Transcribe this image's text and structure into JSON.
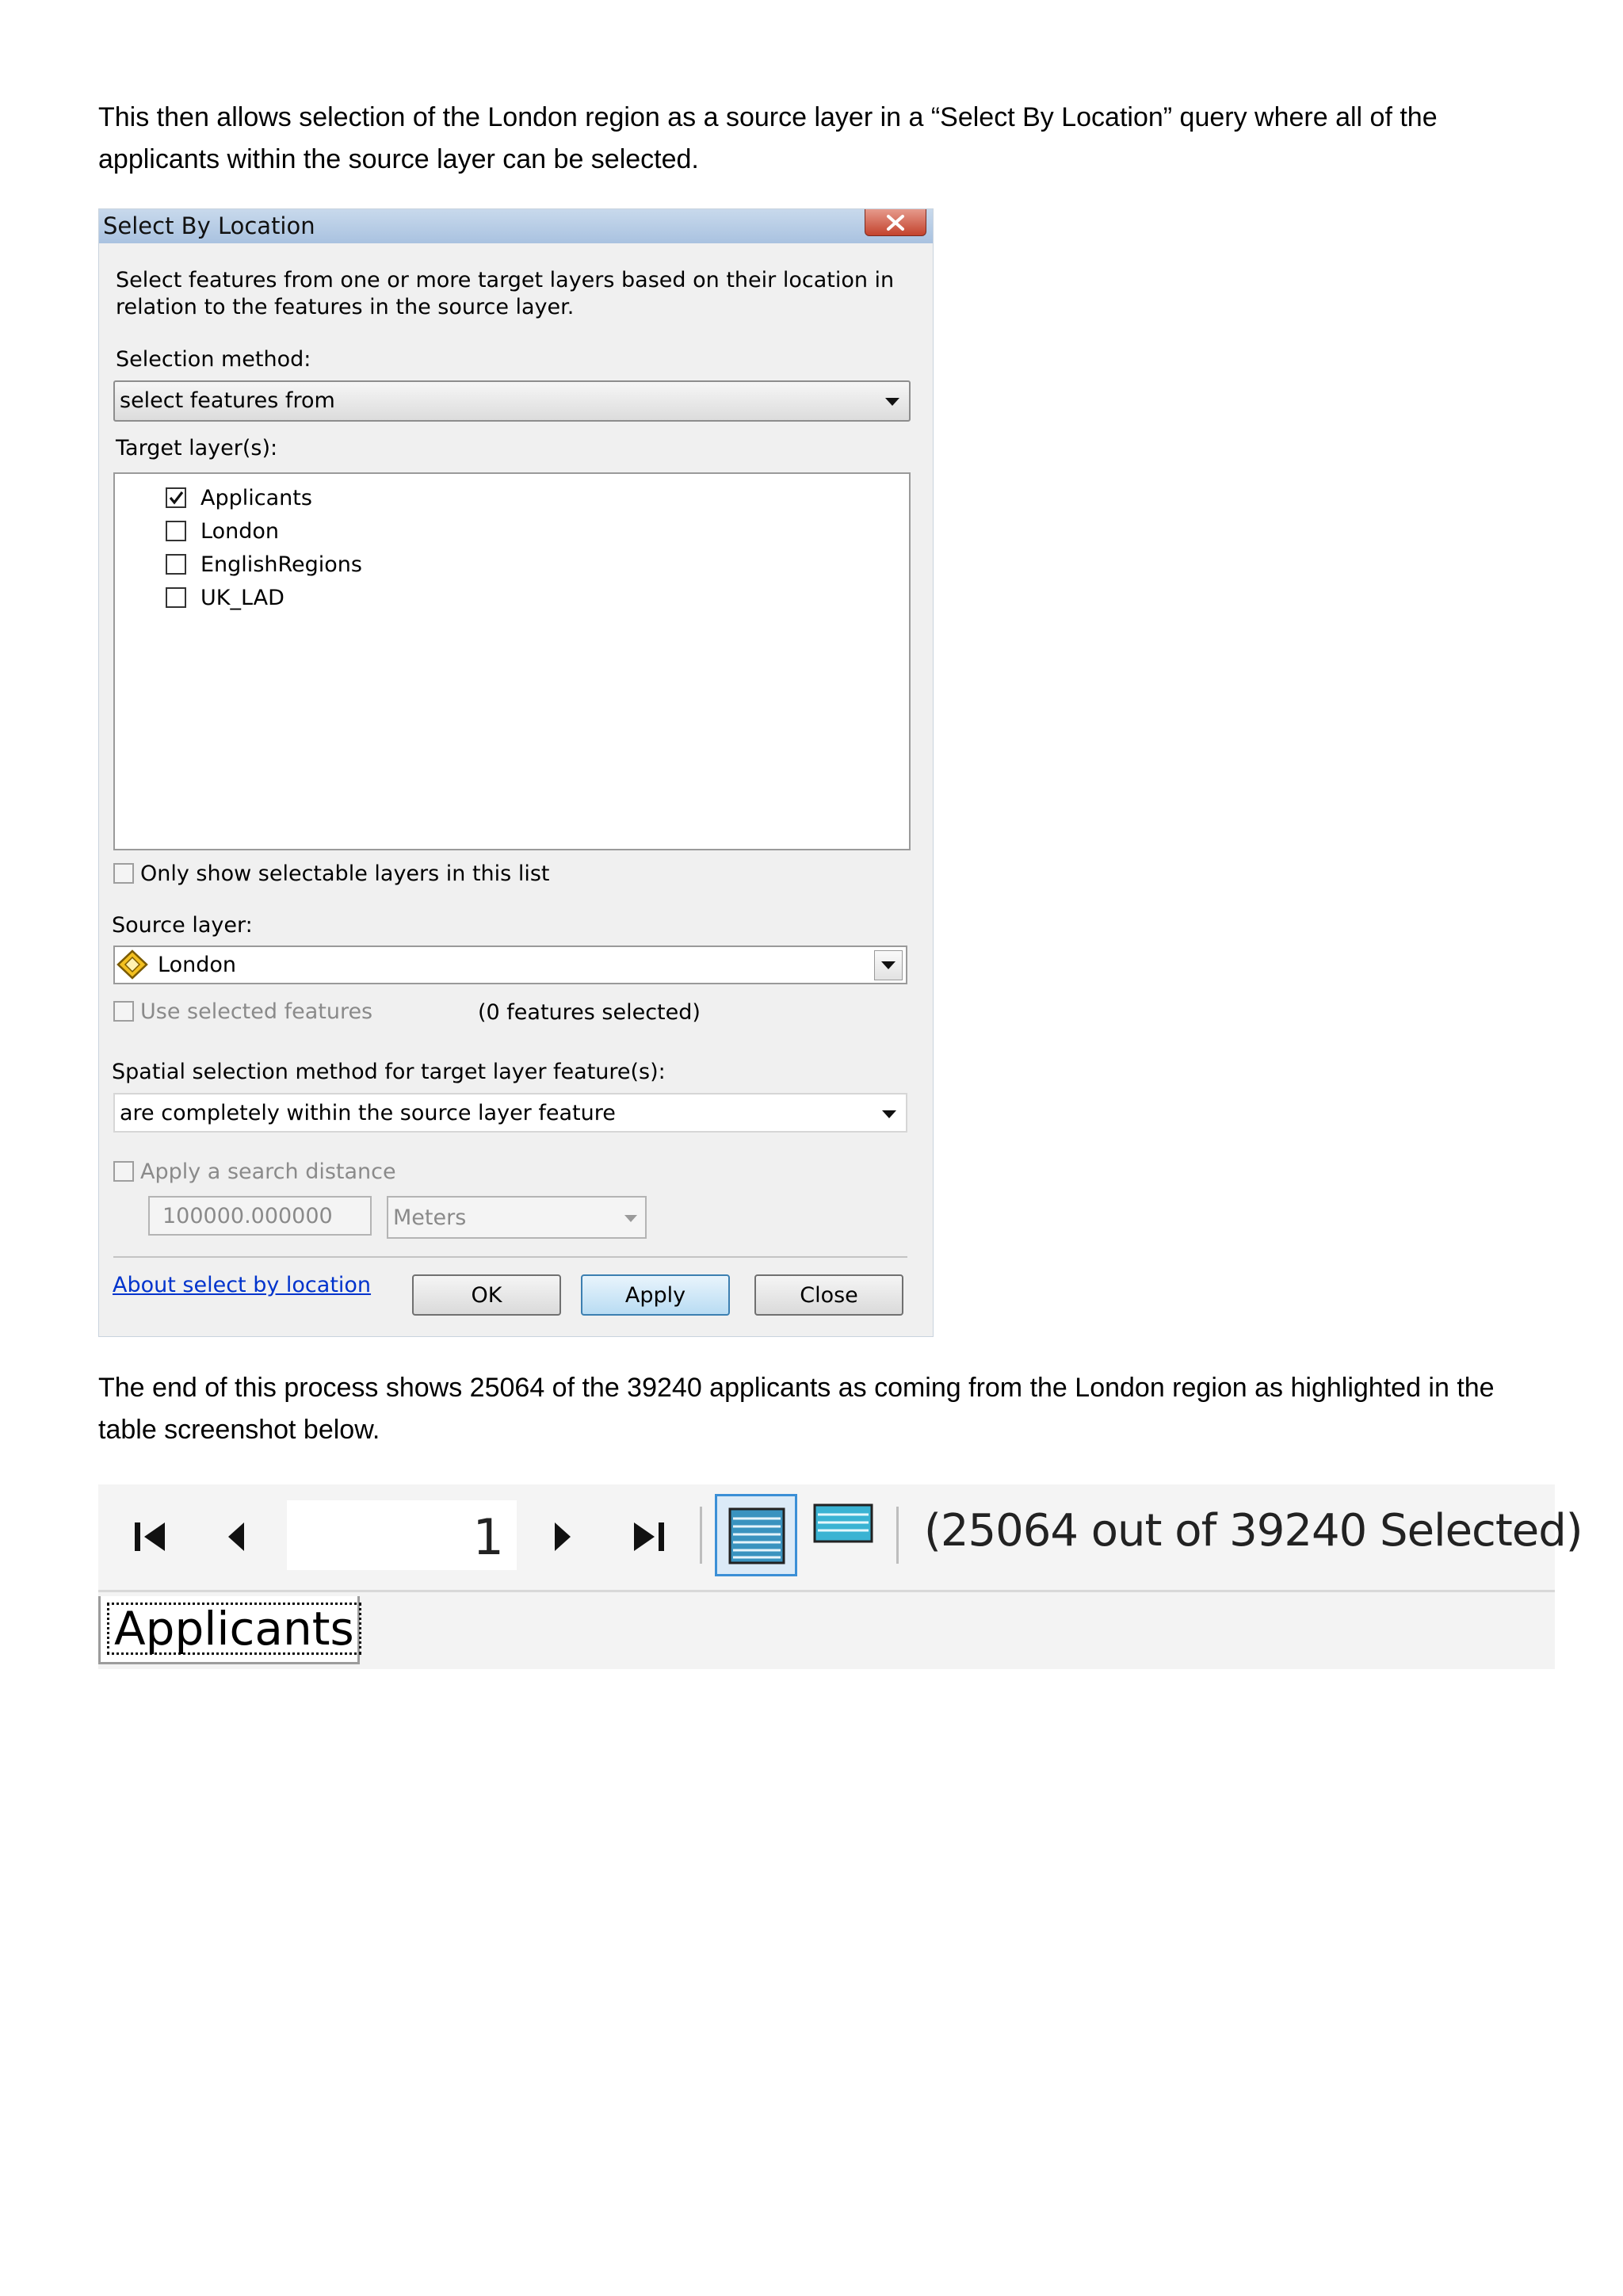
{
  "intro_text": "This then allows selection of the London region as a source layer in a “Select By Location” query where all of the applicants within the source layer can be selected.",
  "dialog": {
    "title": "Select By Location",
    "description_line1": "Select features from one or more target layers based on their location in",
    "description_line2": "relation to the features in the source layer.",
    "selection_method_label": "Selection method:",
    "selection_method_value": "select features from",
    "target_layers_label": "Target layer(s):",
    "target_layers": [
      {
        "name": "Applicants",
        "checked": true
      },
      {
        "name": "London",
        "checked": false
      },
      {
        "name": "EnglishRegions",
        "checked": false
      },
      {
        "name": "UK_LAD",
        "checked": false
      }
    ],
    "only_selectable_label": "Only show selectable layers in this list",
    "source_layer_label": "Source layer:",
    "source_layer_value": "London",
    "use_selected_label": "Use selected features",
    "features_selected": "(0 features selected)",
    "spatial_method_label": "Spatial selection method for target layer feature(s):",
    "spatial_method_value": "are completely within the source layer feature",
    "search_distance_label": "Apply a search distance",
    "search_distance_value": "100000.000000",
    "units_value": "Meters",
    "help_link": "About select by location",
    "ok_label": "OK",
    "apply_label": "Apply",
    "close_label": "Close"
  },
  "result_text": "The end of this process shows 25064 of the 39240 applicants as coming from the London region as highlighted in the table screenshot below.",
  "table_toolbar": {
    "page_number": "1",
    "selection_status": "(25064 out of 39240 Selected)",
    "tab_label": "Applicants"
  }
}
